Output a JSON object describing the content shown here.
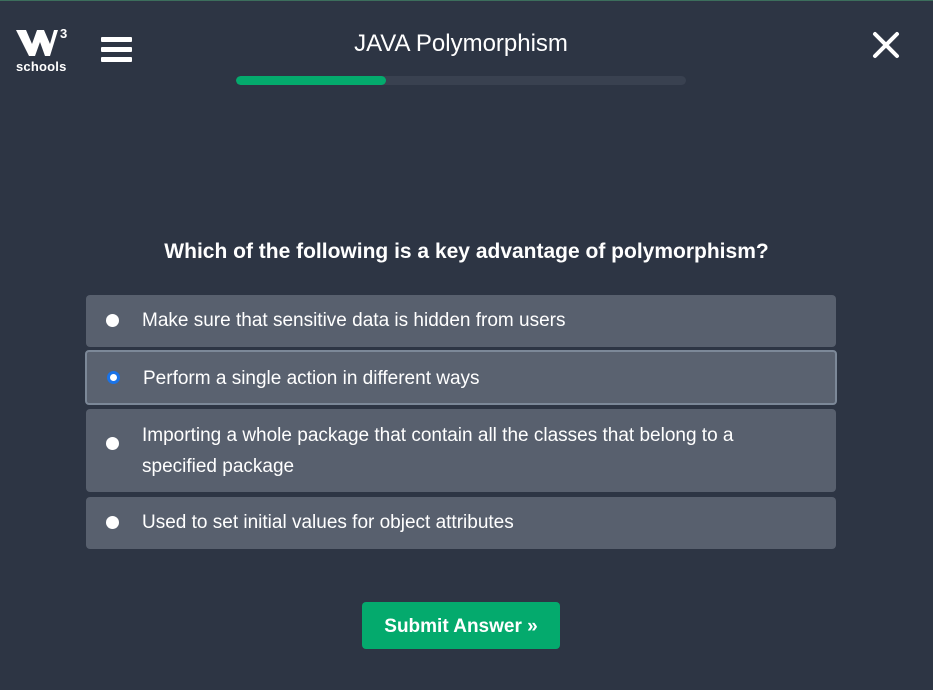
{
  "header": {
    "logo_text": "schools",
    "logo_mark": "W3",
    "title": "JAVA Polymorphism",
    "progress_fraction": 0.333
  },
  "question": "Which of the following is a key advantage of polymorphism?",
  "options": [
    {
      "label": "Make sure that sensitive data is hidden from users",
      "selected": false
    },
    {
      "label": "Perform a single action in different ways",
      "selected": true
    },
    {
      "label": "Importing a whole package that contain all the classes that belong to a specified package",
      "selected": false
    },
    {
      "label": "Used to set initial values for object attributes",
      "selected": false
    }
  ],
  "submit_label": "Submit Answer »",
  "colors": {
    "background": "#2d3544",
    "option_bg": "#58606e",
    "accent": "#04aa6d",
    "radio_checked": "#1a73e8"
  },
  "icons": {
    "menu": "hamburger-icon",
    "close": "close-icon",
    "logo": "w3schools-logo"
  }
}
